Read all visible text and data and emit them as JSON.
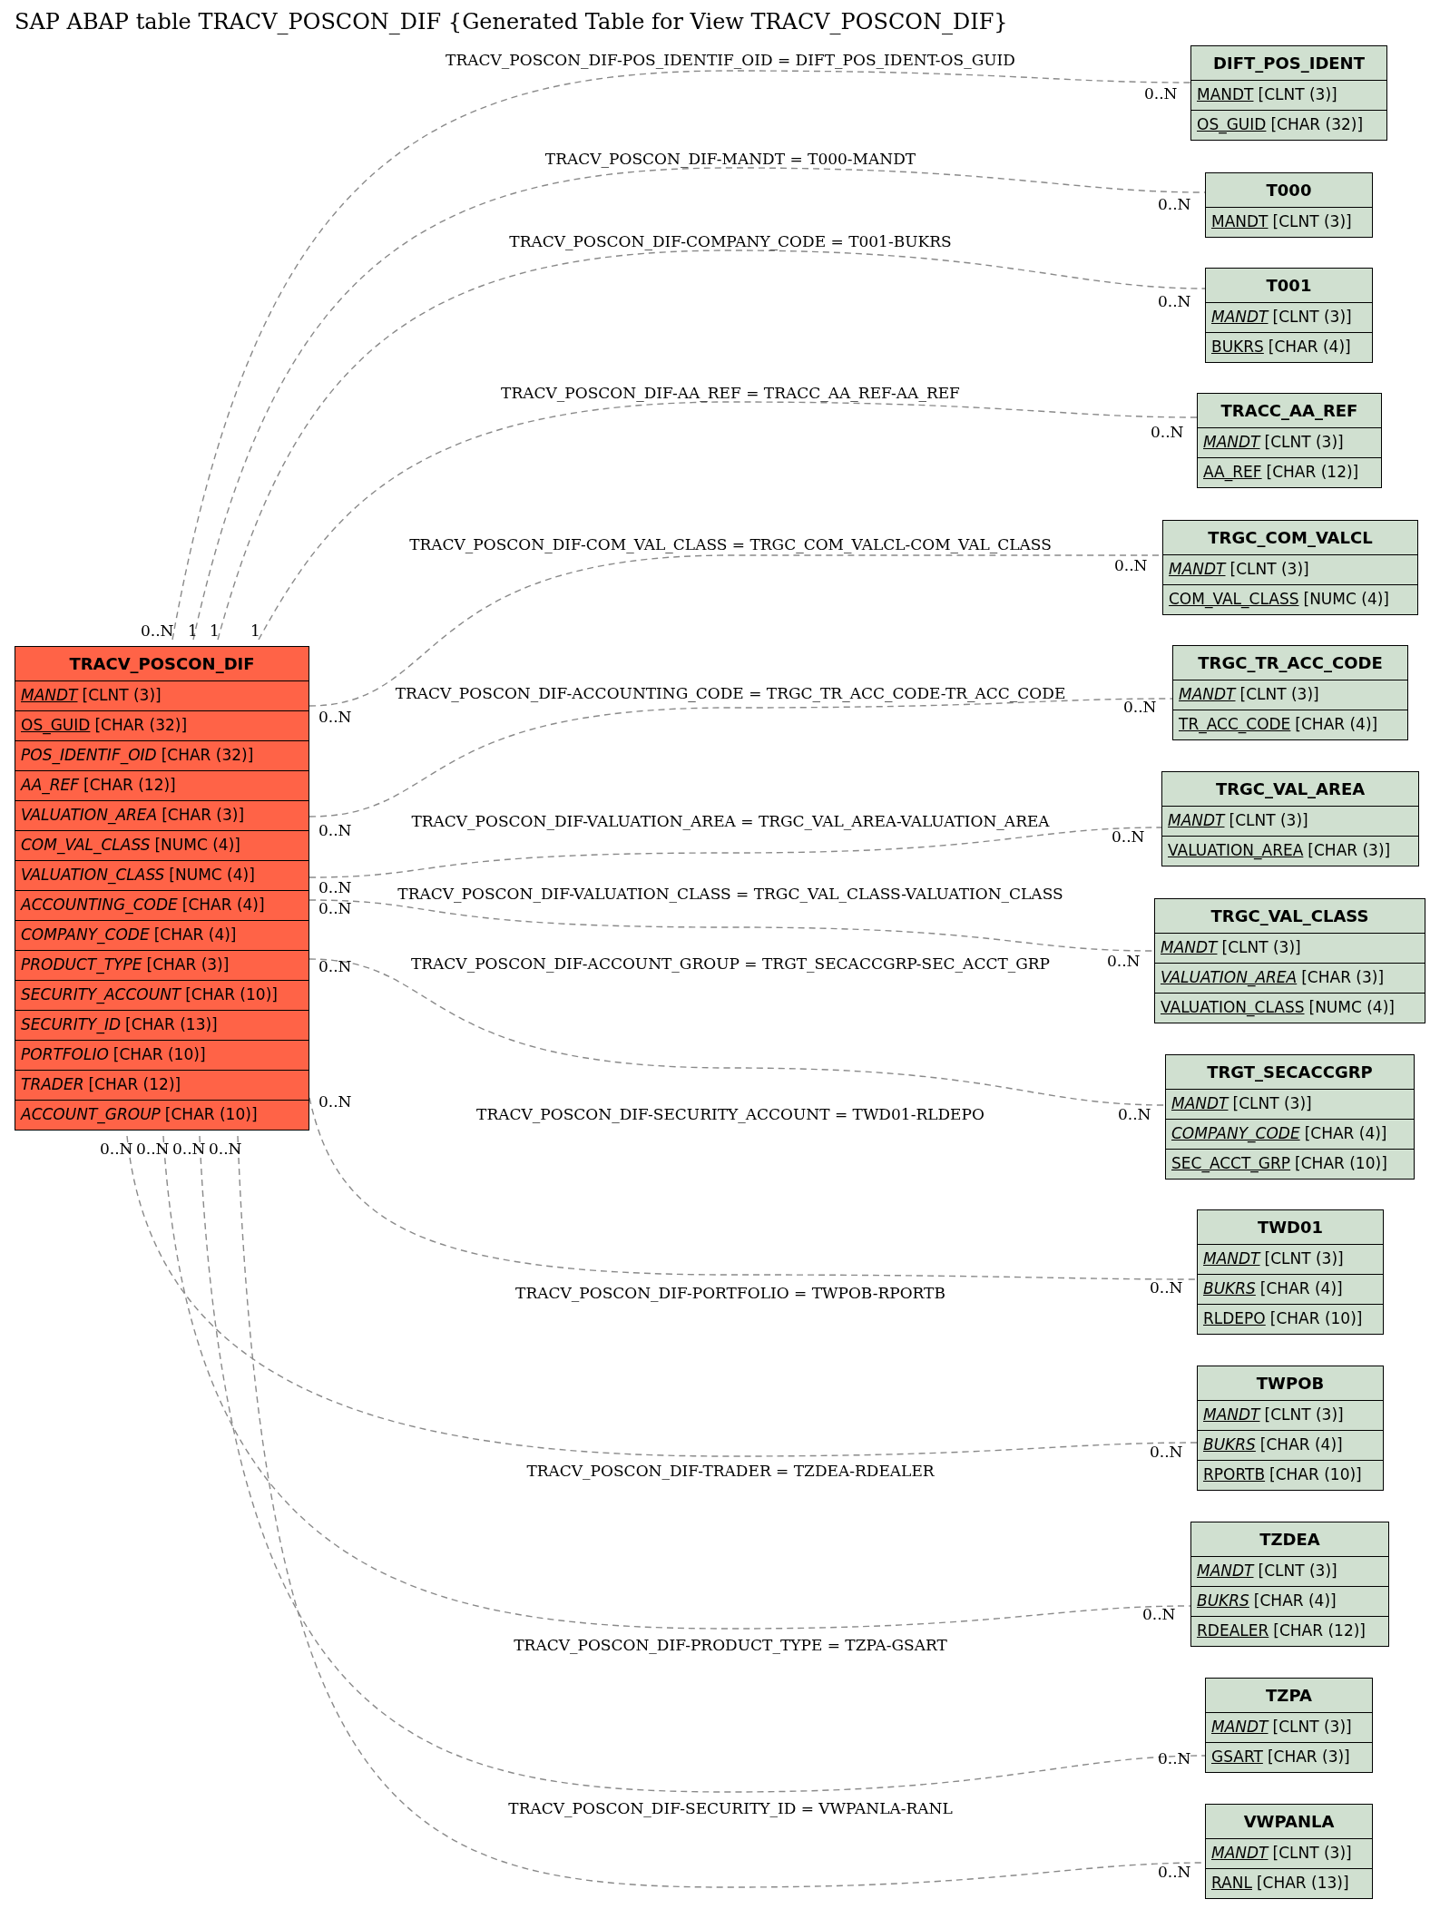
{
  "title": "SAP ABAP table TRACV_POSCON_DIF {Generated Table for View TRACV_POSCON_DIF}",
  "main_table": {
    "name": "TRACV_POSCON_DIF",
    "fields": [
      {
        "name": "MANDT",
        "type": "[CLNT (3)]",
        "key": true,
        "foreign": true
      },
      {
        "name": "OS_GUID",
        "type": "[CHAR (32)]",
        "key": true,
        "foreign": false
      },
      {
        "name": "POS_IDENTIF_OID",
        "type": "[CHAR (32)]",
        "key": false,
        "foreign": true
      },
      {
        "name": "AA_REF",
        "type": "[CHAR (12)]",
        "key": false,
        "foreign": true
      },
      {
        "name": "VALUATION_AREA",
        "type": "[CHAR (3)]",
        "key": false,
        "foreign": true
      },
      {
        "name": "COM_VAL_CLASS",
        "type": "[NUMC (4)]",
        "key": false,
        "foreign": true
      },
      {
        "name": "VALUATION_CLASS",
        "type": "[NUMC (4)]",
        "key": false,
        "foreign": true
      },
      {
        "name": "ACCOUNTING_CODE",
        "type": "[CHAR (4)]",
        "key": false,
        "foreign": true
      },
      {
        "name": "COMPANY_CODE",
        "type": "[CHAR (4)]",
        "key": false,
        "foreign": true
      },
      {
        "name": "PRODUCT_TYPE",
        "type": "[CHAR (3)]",
        "key": false,
        "foreign": true
      },
      {
        "name": "SECURITY_ACCOUNT",
        "type": "[CHAR (10)]",
        "key": false,
        "foreign": true
      },
      {
        "name": "SECURITY_ID",
        "type": "[CHAR (13)]",
        "key": false,
        "foreign": true
      },
      {
        "name": "PORTFOLIO",
        "type": "[CHAR (10)]",
        "key": false,
        "foreign": true
      },
      {
        "name": "TRADER",
        "type": "[CHAR (12)]",
        "key": false,
        "foreign": true
      },
      {
        "name": "ACCOUNT_GROUP",
        "type": "[CHAR (10)]",
        "key": false,
        "foreign": true
      }
    ]
  },
  "related_tables": [
    {
      "name": "DIFT_POS_IDENT",
      "fields": [
        {
          "name": "MANDT",
          "type": "[CLNT (3)]",
          "key": true,
          "foreign": false
        },
        {
          "name": "OS_GUID",
          "type": "[CHAR (32)]",
          "key": true,
          "foreign": false
        }
      ]
    },
    {
      "name": "T000",
      "fields": [
        {
          "name": "MANDT",
          "type": "[CLNT (3)]",
          "key": true,
          "foreign": false
        }
      ]
    },
    {
      "name": "T001",
      "fields": [
        {
          "name": "MANDT",
          "type": "[CLNT (3)]",
          "key": true,
          "foreign": true
        },
        {
          "name": "BUKRS",
          "type": "[CHAR (4)]",
          "key": true,
          "foreign": false
        }
      ]
    },
    {
      "name": "TRACC_AA_REF",
      "fields": [
        {
          "name": "MANDT",
          "type": "[CLNT (3)]",
          "key": true,
          "foreign": true
        },
        {
          "name": "AA_REF",
          "type": "[CHAR (12)]",
          "key": true,
          "foreign": false
        }
      ]
    },
    {
      "name": "TRGC_COM_VALCL",
      "fields": [
        {
          "name": "MANDT",
          "type": "[CLNT (3)]",
          "key": true,
          "foreign": true
        },
        {
          "name": "COM_VAL_CLASS",
          "type": "[NUMC (4)]",
          "key": true,
          "foreign": false
        }
      ]
    },
    {
      "name": "TRGC_TR_ACC_CODE",
      "fields": [
        {
          "name": "MANDT",
          "type": "[CLNT (3)]",
          "key": true,
          "foreign": true
        },
        {
          "name": "TR_ACC_CODE",
          "type": "[CHAR (4)]",
          "key": true,
          "foreign": false
        }
      ]
    },
    {
      "name": "TRGC_VAL_AREA",
      "fields": [
        {
          "name": "MANDT",
          "type": "[CLNT (3)]",
          "key": true,
          "foreign": true
        },
        {
          "name": "VALUATION_AREA",
          "type": "[CHAR (3)]",
          "key": true,
          "foreign": false
        }
      ]
    },
    {
      "name": "TRGC_VAL_CLASS",
      "fields": [
        {
          "name": "MANDT",
          "type": "[CLNT (3)]",
          "key": true,
          "foreign": true
        },
        {
          "name": "VALUATION_AREA",
          "type": "[CHAR (3)]",
          "key": true,
          "foreign": true
        },
        {
          "name": "VALUATION_CLASS",
          "type": "[NUMC (4)]",
          "key": true,
          "foreign": false
        }
      ]
    },
    {
      "name": "TRGT_SECACCGRP",
      "fields": [
        {
          "name": "MANDT",
          "type": "[CLNT (3)]",
          "key": true,
          "foreign": true
        },
        {
          "name": "COMPANY_CODE",
          "type": "[CHAR (4)]",
          "key": true,
          "foreign": true
        },
        {
          "name": "SEC_ACCT_GRP",
          "type": "[CHAR (10)]",
          "key": true,
          "foreign": false
        }
      ]
    },
    {
      "name": "TWD01",
      "fields": [
        {
          "name": "MANDT",
          "type": "[CLNT (3)]",
          "key": true,
          "foreign": true
        },
        {
          "name": "BUKRS",
          "type": "[CHAR (4)]",
          "key": true,
          "foreign": true
        },
        {
          "name": "RLDEPO",
          "type": "[CHAR (10)]",
          "key": true,
          "foreign": false
        }
      ]
    },
    {
      "name": "TWPOB",
      "fields": [
        {
          "name": "MANDT",
          "type": "[CLNT (3)]",
          "key": true,
          "foreign": true
        },
        {
          "name": "BUKRS",
          "type": "[CHAR (4)]",
          "key": true,
          "foreign": true
        },
        {
          "name": "RPORTB",
          "type": "[CHAR (10)]",
          "key": true,
          "foreign": false
        }
      ]
    },
    {
      "name": "TZDEA",
      "fields": [
        {
          "name": "MANDT",
          "type": "[CLNT (3)]",
          "key": true,
          "foreign": true
        },
        {
          "name": "BUKRS",
          "type": "[CHAR (4)]",
          "key": true,
          "foreign": true
        },
        {
          "name": "RDEALER",
          "type": "[CHAR (12)]",
          "key": true,
          "foreign": false
        }
      ]
    },
    {
      "name": "TZPA",
      "fields": [
        {
          "name": "MANDT",
          "type": "[CLNT (3)]",
          "key": true,
          "foreign": true
        },
        {
          "name": "GSART",
          "type": "[CHAR (3)]",
          "key": true,
          "foreign": false
        }
      ]
    },
    {
      "name": "VWPANLA",
      "fields": [
        {
          "name": "MANDT",
          "type": "[CLNT (3)]",
          "key": true,
          "foreign": true
        },
        {
          "name": "RANL",
          "type": "[CHAR (13)]",
          "key": true,
          "foreign": false
        }
      ]
    }
  ],
  "relations": [
    {
      "label": "TRACV_POSCON_DIF-POS_IDENTIF_OID = DIFT_POS_IDENT-OS_GUID",
      "from_card": "0..N",
      "to_card": "0..N"
    },
    {
      "label": "TRACV_POSCON_DIF-MANDT = T000-MANDT",
      "from_card": "1",
      "to_card": "0..N"
    },
    {
      "label": "TRACV_POSCON_DIF-COMPANY_CODE = T001-BUKRS",
      "from_card": "1",
      "to_card": "0..N"
    },
    {
      "label": "TRACV_POSCON_DIF-AA_REF = TRACC_AA_REF-AA_REF",
      "from_card": "1",
      "to_card": "0..N"
    },
    {
      "label": "TRACV_POSCON_DIF-COM_VAL_CLASS = TRGC_COM_VALCL-COM_VAL_CLASS",
      "from_card": "0..N",
      "to_card": "0..N"
    },
    {
      "label": "TRACV_POSCON_DIF-ACCOUNTING_CODE = TRGC_TR_ACC_CODE-TR_ACC_CODE",
      "from_card": "0..N",
      "to_card": "0..N"
    },
    {
      "label": "TRACV_POSCON_DIF-VALUATION_AREA = TRGC_VAL_AREA-VALUATION_AREA",
      "from_card": "0..N",
      "to_card": "0..N"
    },
    {
      "label": "TRACV_POSCON_DIF-VALUATION_CLASS = TRGC_VAL_CLASS-VALUATION_CLASS",
      "from_card": "0..N",
      "to_card": "0..N"
    },
    {
      "label": "TRACV_POSCON_DIF-ACCOUNT_GROUP = TRGT_SECACCGRP-SEC_ACCT_GRP",
      "from_card": "0..N",
      "to_card": "0..N"
    },
    {
      "label": "TRACV_POSCON_DIF-SECURITY_ACCOUNT = TWD01-RLDEPO",
      "from_card": "0..N",
      "to_card": "0..N"
    },
    {
      "label": "TRACV_POSCON_DIF-PORTFOLIO = TWPOB-RPORTB",
      "from_card": "0..N",
      "to_card": "0..N"
    },
    {
      "label": "TRACV_POSCON_DIF-TRADER = TZDEA-RDEALER",
      "from_card": "0..N",
      "to_card": "0..N"
    },
    {
      "label": "TRACV_POSCON_DIF-PRODUCT_TYPE = TZPA-GSART",
      "from_card": "0..N",
      "to_card": "0..N"
    },
    {
      "label": "TRACV_POSCON_DIF-SECURITY_ID = VWPANLA-RANL",
      "from_card": "0..N",
      "to_card": "0..N"
    }
  ]
}
